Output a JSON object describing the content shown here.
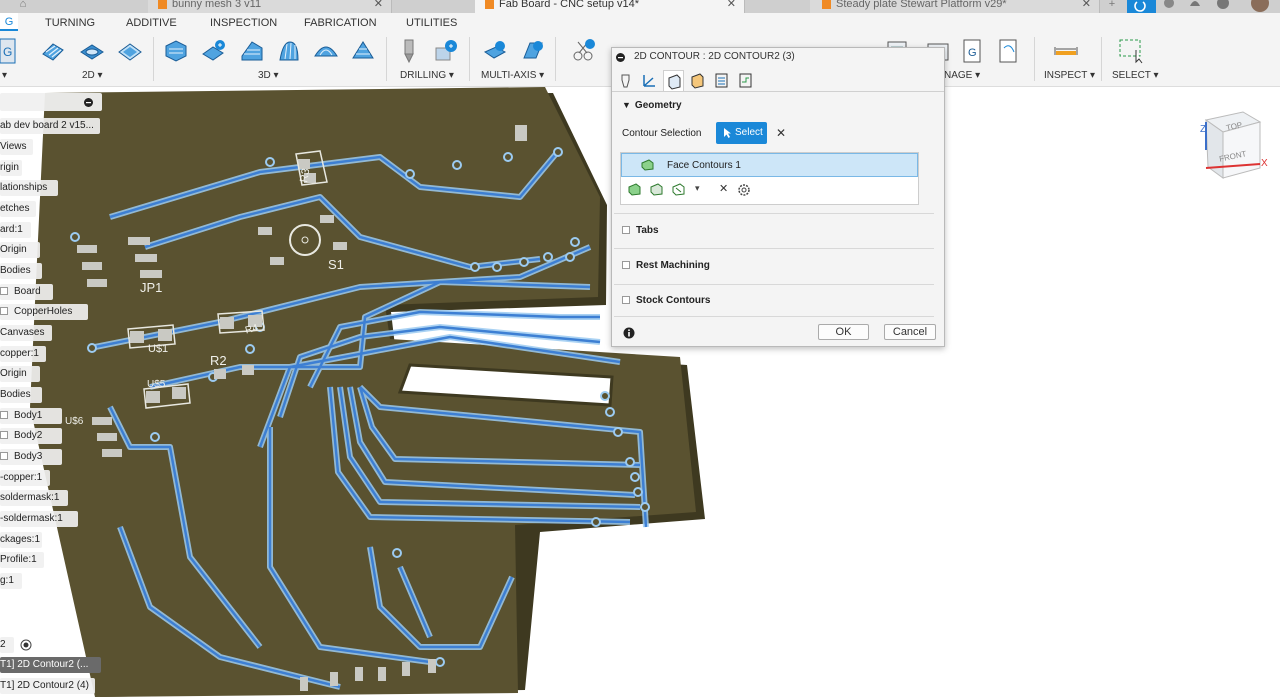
{
  "tabs": [
    {
      "label": "bunny mesh 3 v11",
      "close": "✕"
    },
    {
      "label": "Fab Board - CNC setup v14*",
      "close": "✕"
    },
    {
      "label": "Steady plate Stewart Platform v29*",
      "close": "✕"
    }
  ],
  "tab_controls": {
    "new": "+"
  },
  "ribbon": {
    "workspace_letter": "G",
    "tabs": [
      "TURNING",
      "ADDITIVE",
      "INSPECTION",
      "FABRICATION",
      "UTILITIES"
    ],
    "groups": {
      "g2d": "2D ▾",
      "g3d": "3D ▾",
      "drilling": "DRILLING ▾",
      "multiaxis": "MULTI-AXIS ▾",
      "manage": "NAGE ▾",
      "inspect": "INSPECT ▾",
      "select": "SELECT ▾"
    },
    "dropdown_marker": "▾"
  },
  "browser": {
    "items": [
      {
        "label": "ab dev board 2 v15...",
        "cb": false,
        "indent": 0
      },
      {
        "label": "Views",
        "cb": false,
        "indent": 0
      },
      {
        "label": "rigin",
        "cb": false,
        "indent": 0
      },
      {
        "label": "lationships",
        "cb": false,
        "indent": 0
      },
      {
        "label": "etches",
        "cb": false,
        "indent": 0
      },
      {
        "label": "ard:1",
        "cb": false,
        "indent": 0
      },
      {
        "label": "Origin",
        "cb": false,
        "indent": 0
      },
      {
        "label": "Bodies",
        "cb": false,
        "indent": 0
      },
      {
        "label": "Board",
        "cb": true,
        "indent": 0
      },
      {
        "label": "CopperHoles",
        "cb": true,
        "indent": 0
      },
      {
        "label": "Canvases",
        "cb": false,
        "indent": 0
      },
      {
        "label": "copper:1",
        "cb": false,
        "indent": 0
      },
      {
        "label": "Origin",
        "cb": false,
        "indent": 0
      },
      {
        "label": "Bodies",
        "cb": false,
        "indent": 0
      },
      {
        "label": "Body1",
        "cb": true,
        "indent": 0
      },
      {
        "label": "Body2",
        "cb": true,
        "indent": 0
      },
      {
        "label": "Body3",
        "cb": true,
        "indent": 0
      },
      {
        "label": "-copper:1",
        "cb": false,
        "indent": 0
      },
      {
        "label": "soldermask:1",
        "cb": false,
        "indent": 0
      },
      {
        "label": "-soldermask:1",
        "cb": false,
        "indent": 0
      },
      {
        "label": "ckages:1",
        "cb": false,
        "indent": 0
      },
      {
        "label": "Profile:1",
        "cb": false,
        "indent": 0
      },
      {
        "label": "g:1",
        "cb": false,
        "indent": 0
      }
    ],
    "setup_label": "2",
    "ops": [
      "T1] 2D Contour2 (...",
      "T1] 2D Contour2 (4)"
    ]
  },
  "dialog": {
    "title": "2D CONTOUR : 2D CONTOUR2 (3)",
    "geometry_header": "Geometry",
    "contour_selection_label": "Contour Selection",
    "select_button": "Select",
    "clear": "✕",
    "selection_item": "Face Contours 1",
    "tabs_label": "Tabs",
    "rest_label": "Rest Machining",
    "stock_label": "Stock Contours",
    "ok": "OK",
    "cancel": "Cancel"
  },
  "viewcube": {
    "top": "TOP",
    "front": "FRONT",
    "x": "X",
    "z": "Z"
  },
  "board": {
    "refdes": [
      "R3",
      "S1",
      "JP1",
      "U$1",
      "R4",
      "R2",
      "U$5",
      "U$6"
    ]
  },
  "colors": {
    "board": "#5a5230",
    "board_edge": "#3e3920",
    "trace": "#3d7fd3",
    "trace_glow": "#9ccbf1",
    "accent": "#1a88d8"
  }
}
